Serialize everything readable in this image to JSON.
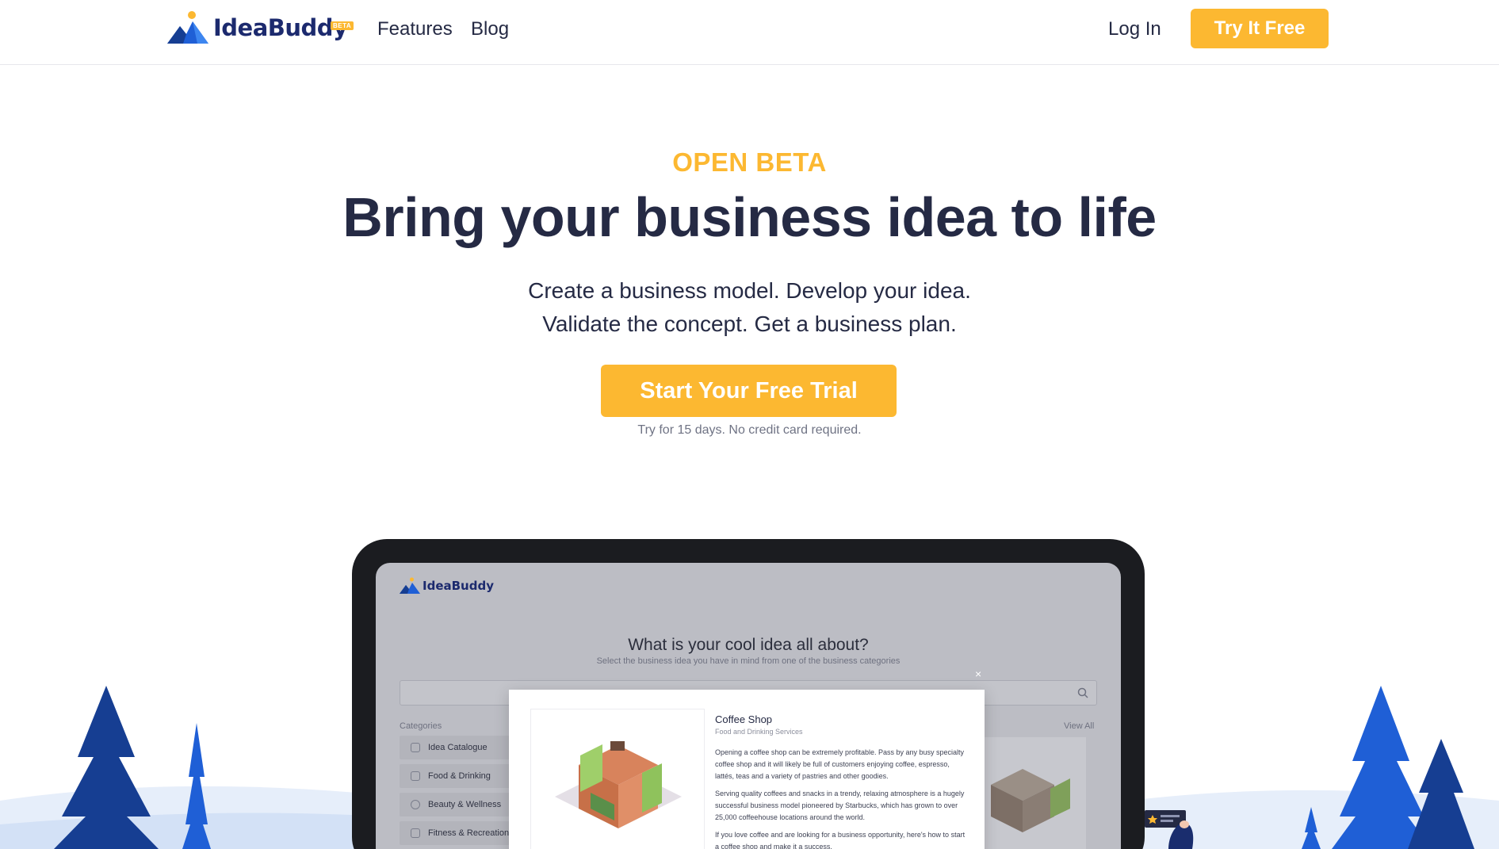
{
  "nav": {
    "logo_text": "IdeaBuddy",
    "logo_badge": "BETA",
    "links": [
      "Features",
      "Blog"
    ],
    "login": "Log In",
    "cta": "Try It Free"
  },
  "hero": {
    "kicker": "OPEN BETA",
    "title": "Bring your business idea to life",
    "subtitle_line1": "Create a business model. Develop your idea.",
    "subtitle_line2": "Validate the concept. Get a business plan.",
    "cta": "Start Your Free Trial",
    "note": "Try for 15 days. No credit card required."
  },
  "app_preview": {
    "logo_text": "IdeaBuddy",
    "title": "What is your cool idea all about?",
    "subtitle": "Select the business idea you have in mind from one of the business categories",
    "categories_label": "Categories",
    "view_all": "View All",
    "close": "×",
    "categories": [
      "Idea Catalogue",
      "Food & Drinking",
      "Beauty & Wellness",
      "Fitness & Recreation"
    ],
    "modal": {
      "title": "Coffee Shop",
      "subtitle": "Food and Drinking Services",
      "p1": "Opening a coffee shop can be extremely profitable. Pass by any busy specialty coffee shop and it will likely be full of customers enjoying coffee, espresso, lattés, teas and a variety of pastries and other goodies.",
      "p2": "Serving quality coffees and snacks in a trendy, relaxing atmosphere is a hugely successful business model pioneered by Starbucks, which has grown to over 25,000 coffeehouse locations around the world.",
      "p3": "If you love coffee and are looking for a business opportunity, here's how to start a coffee shop and make it a success."
    }
  },
  "colors": {
    "accent": "#fcb831",
    "text_dark": "#252a44",
    "brand_blue": "#1c2a6e",
    "tree_blue": "#1f5fd6",
    "tree_dark": "#163e92"
  }
}
